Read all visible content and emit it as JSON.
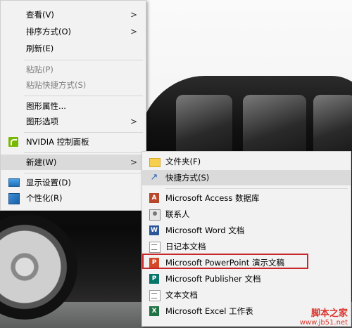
{
  "context_menu": {
    "items": [
      {
        "label": "查看(V)",
        "has_submenu": true,
        "disabled": false
      },
      {
        "label": "排序方式(O)",
        "has_submenu": true,
        "disabled": false
      },
      {
        "label": "刷新(E)",
        "has_submenu": false,
        "disabled": false
      },
      {
        "label": "粘贴(P)",
        "has_submenu": false,
        "disabled": true
      },
      {
        "label": "粘贴快捷方式(S)",
        "has_submenu": false,
        "disabled": true
      },
      {
        "label": "图形属性...",
        "has_submenu": false,
        "disabled": false
      },
      {
        "label": "图形选项",
        "has_submenu": true,
        "disabled": false
      },
      {
        "label": "NVIDIA 控制面板",
        "has_submenu": false,
        "disabled": false,
        "icon": "nvidia-icon"
      },
      {
        "label": "新建(W)",
        "has_submenu": true,
        "disabled": false,
        "highlighted": true
      },
      {
        "label": "显示设置(D)",
        "has_submenu": false,
        "disabled": false,
        "icon": "display-settings-icon"
      },
      {
        "label": "个性化(R)",
        "has_submenu": false,
        "disabled": false,
        "icon": "personalize-icon"
      }
    ],
    "arrow_glyph": ">"
  },
  "new_submenu": {
    "items": [
      {
        "label": "文件夹(F)",
        "icon": "folder-icon"
      },
      {
        "label": "快捷方式(S)",
        "icon": "shortcut-icon",
        "highlighted": true
      },
      {
        "label": "Microsoft Access 数据库",
        "icon": "access-icon"
      },
      {
        "label": "联系人",
        "icon": "contact-icon"
      },
      {
        "label": "Microsoft Word 文档",
        "icon": "word-icon"
      },
      {
        "label": "日记本文档",
        "icon": "journal-icon"
      },
      {
        "label": "Microsoft PowerPoint 演示文稿",
        "icon": "powerpoint-icon",
        "outlined": true
      },
      {
        "label": "Microsoft Publisher 文档",
        "icon": "publisher-icon"
      },
      {
        "label": "文本文档",
        "icon": "text-document-icon"
      },
      {
        "label": "Microsoft Excel 工作表",
        "icon": "excel-icon"
      }
    ]
  },
  "icon_glyphs": {
    "shortcut": "↗",
    "access": "A",
    "word": "W",
    "powerpoint": "P",
    "publisher": "P",
    "excel": "X"
  },
  "watermark": {
    "line1": "脚本之家",
    "line2": "www.jb51.net"
  },
  "colors": {
    "highlight_box": "#c8282b",
    "menu_bg": "#f2f2f2",
    "menu_highlight": "#dadada"
  }
}
